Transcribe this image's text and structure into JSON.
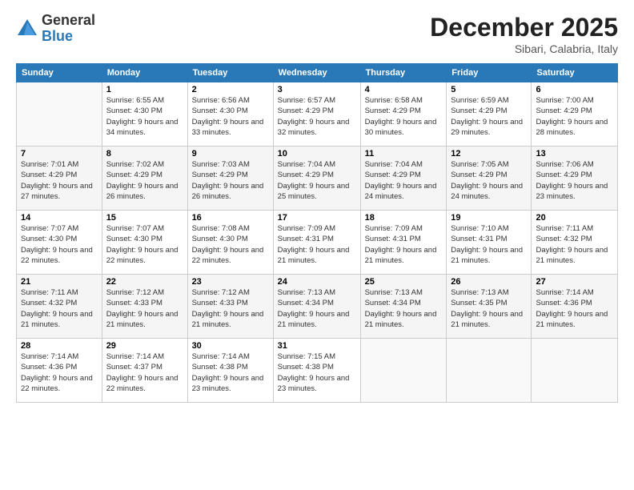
{
  "logo": {
    "general": "General",
    "blue": "Blue"
  },
  "title": "December 2025",
  "location": "Sibari, Calabria, Italy",
  "headers": [
    "Sunday",
    "Monday",
    "Tuesday",
    "Wednesday",
    "Thursday",
    "Friday",
    "Saturday"
  ],
  "weeks": [
    [
      {
        "day": "",
        "sunrise": "",
        "sunset": "",
        "daylight": ""
      },
      {
        "day": "1",
        "sunrise": "Sunrise: 6:55 AM",
        "sunset": "Sunset: 4:30 PM",
        "daylight": "Daylight: 9 hours and 34 minutes."
      },
      {
        "day": "2",
        "sunrise": "Sunrise: 6:56 AM",
        "sunset": "Sunset: 4:30 PM",
        "daylight": "Daylight: 9 hours and 33 minutes."
      },
      {
        "day": "3",
        "sunrise": "Sunrise: 6:57 AM",
        "sunset": "Sunset: 4:29 PM",
        "daylight": "Daylight: 9 hours and 32 minutes."
      },
      {
        "day": "4",
        "sunrise": "Sunrise: 6:58 AM",
        "sunset": "Sunset: 4:29 PM",
        "daylight": "Daylight: 9 hours and 30 minutes."
      },
      {
        "day": "5",
        "sunrise": "Sunrise: 6:59 AM",
        "sunset": "Sunset: 4:29 PM",
        "daylight": "Daylight: 9 hours and 29 minutes."
      },
      {
        "day": "6",
        "sunrise": "Sunrise: 7:00 AM",
        "sunset": "Sunset: 4:29 PM",
        "daylight": "Daylight: 9 hours and 28 minutes."
      }
    ],
    [
      {
        "day": "7",
        "sunrise": "Sunrise: 7:01 AM",
        "sunset": "Sunset: 4:29 PM",
        "daylight": "Daylight: 9 hours and 27 minutes."
      },
      {
        "day": "8",
        "sunrise": "Sunrise: 7:02 AM",
        "sunset": "Sunset: 4:29 PM",
        "daylight": "Daylight: 9 hours and 26 minutes."
      },
      {
        "day": "9",
        "sunrise": "Sunrise: 7:03 AM",
        "sunset": "Sunset: 4:29 PM",
        "daylight": "Daylight: 9 hours and 26 minutes."
      },
      {
        "day": "10",
        "sunrise": "Sunrise: 7:04 AM",
        "sunset": "Sunset: 4:29 PM",
        "daylight": "Daylight: 9 hours and 25 minutes."
      },
      {
        "day": "11",
        "sunrise": "Sunrise: 7:04 AM",
        "sunset": "Sunset: 4:29 PM",
        "daylight": "Daylight: 9 hours and 24 minutes."
      },
      {
        "day": "12",
        "sunrise": "Sunrise: 7:05 AM",
        "sunset": "Sunset: 4:29 PM",
        "daylight": "Daylight: 9 hours and 24 minutes."
      },
      {
        "day": "13",
        "sunrise": "Sunrise: 7:06 AM",
        "sunset": "Sunset: 4:29 PM",
        "daylight": "Daylight: 9 hours and 23 minutes."
      }
    ],
    [
      {
        "day": "14",
        "sunrise": "Sunrise: 7:07 AM",
        "sunset": "Sunset: 4:30 PM",
        "daylight": "Daylight: 9 hours and 22 minutes."
      },
      {
        "day": "15",
        "sunrise": "Sunrise: 7:07 AM",
        "sunset": "Sunset: 4:30 PM",
        "daylight": "Daylight: 9 hours and 22 minutes."
      },
      {
        "day": "16",
        "sunrise": "Sunrise: 7:08 AM",
        "sunset": "Sunset: 4:30 PM",
        "daylight": "Daylight: 9 hours and 22 minutes."
      },
      {
        "day": "17",
        "sunrise": "Sunrise: 7:09 AM",
        "sunset": "Sunset: 4:31 PM",
        "daylight": "Daylight: 9 hours and 21 minutes."
      },
      {
        "day": "18",
        "sunrise": "Sunrise: 7:09 AM",
        "sunset": "Sunset: 4:31 PM",
        "daylight": "Daylight: 9 hours and 21 minutes."
      },
      {
        "day": "19",
        "sunrise": "Sunrise: 7:10 AM",
        "sunset": "Sunset: 4:31 PM",
        "daylight": "Daylight: 9 hours and 21 minutes."
      },
      {
        "day": "20",
        "sunrise": "Sunrise: 7:11 AM",
        "sunset": "Sunset: 4:32 PM",
        "daylight": "Daylight: 9 hours and 21 minutes."
      }
    ],
    [
      {
        "day": "21",
        "sunrise": "Sunrise: 7:11 AM",
        "sunset": "Sunset: 4:32 PM",
        "daylight": "Daylight: 9 hours and 21 minutes."
      },
      {
        "day": "22",
        "sunrise": "Sunrise: 7:12 AM",
        "sunset": "Sunset: 4:33 PM",
        "daylight": "Daylight: 9 hours and 21 minutes."
      },
      {
        "day": "23",
        "sunrise": "Sunrise: 7:12 AM",
        "sunset": "Sunset: 4:33 PM",
        "daylight": "Daylight: 9 hours and 21 minutes."
      },
      {
        "day": "24",
        "sunrise": "Sunrise: 7:13 AM",
        "sunset": "Sunset: 4:34 PM",
        "daylight": "Daylight: 9 hours and 21 minutes."
      },
      {
        "day": "25",
        "sunrise": "Sunrise: 7:13 AM",
        "sunset": "Sunset: 4:34 PM",
        "daylight": "Daylight: 9 hours and 21 minutes."
      },
      {
        "day": "26",
        "sunrise": "Sunrise: 7:13 AM",
        "sunset": "Sunset: 4:35 PM",
        "daylight": "Daylight: 9 hours and 21 minutes."
      },
      {
        "day": "27",
        "sunrise": "Sunrise: 7:14 AM",
        "sunset": "Sunset: 4:36 PM",
        "daylight": "Daylight: 9 hours and 21 minutes."
      }
    ],
    [
      {
        "day": "28",
        "sunrise": "Sunrise: 7:14 AM",
        "sunset": "Sunset: 4:36 PM",
        "daylight": "Daylight: 9 hours and 22 minutes."
      },
      {
        "day": "29",
        "sunrise": "Sunrise: 7:14 AM",
        "sunset": "Sunset: 4:37 PM",
        "daylight": "Daylight: 9 hours and 22 minutes."
      },
      {
        "day": "30",
        "sunrise": "Sunrise: 7:14 AM",
        "sunset": "Sunset: 4:38 PM",
        "daylight": "Daylight: 9 hours and 23 minutes."
      },
      {
        "day": "31",
        "sunrise": "Sunrise: 7:15 AM",
        "sunset": "Sunset: 4:38 PM",
        "daylight": "Daylight: 9 hours and 23 minutes."
      },
      {
        "day": "",
        "sunrise": "",
        "sunset": "",
        "daylight": ""
      },
      {
        "day": "",
        "sunrise": "",
        "sunset": "",
        "daylight": ""
      },
      {
        "day": "",
        "sunrise": "",
        "sunset": "",
        "daylight": ""
      }
    ]
  ]
}
